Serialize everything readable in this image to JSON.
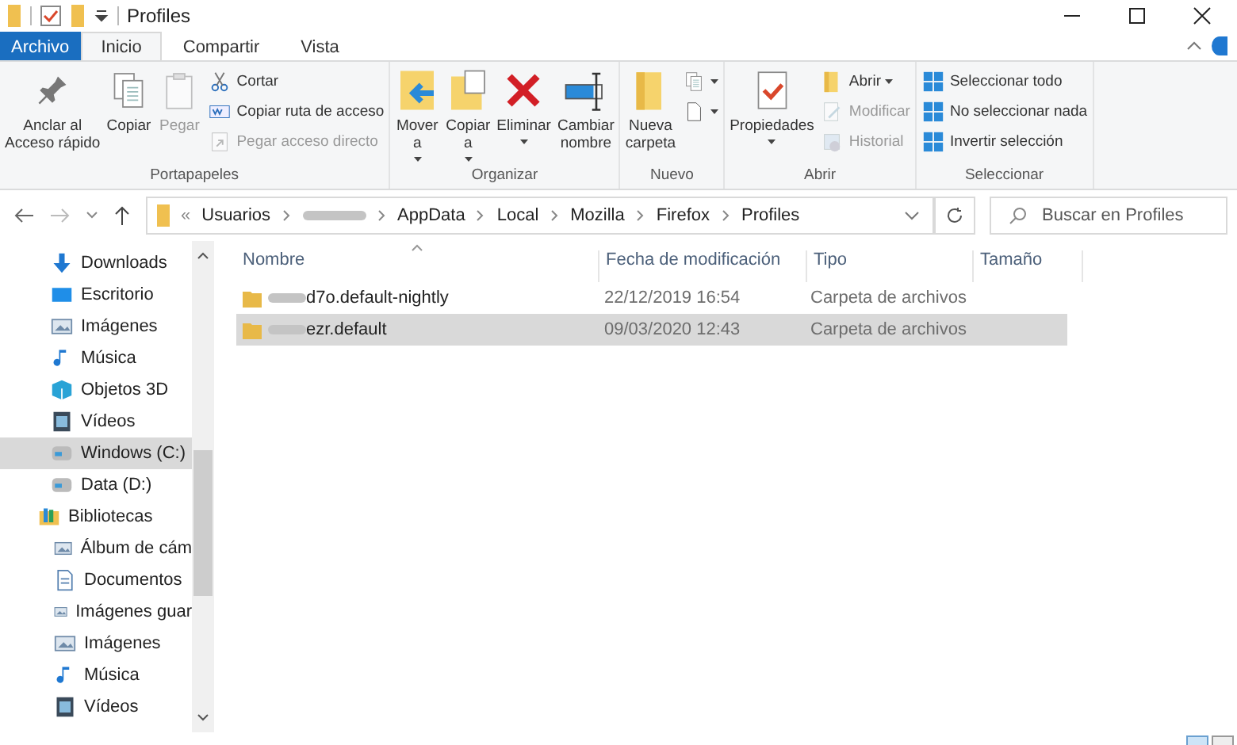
{
  "window": {
    "title": "Profiles"
  },
  "tabs": [
    {
      "label": "Archivo",
      "kind": "file",
      "selected": false
    },
    {
      "label": "Inicio",
      "kind": "tab",
      "selected": true
    },
    {
      "label": "Compartir",
      "kind": "tab",
      "selected": false
    },
    {
      "label": "Vista",
      "kind": "tab",
      "selected": false
    }
  ],
  "ribbon": [
    {
      "label": "Portapapeles",
      "items": [
        {
          "kind": "large",
          "lines": [
            "Anclar al",
            "Acceso rápido"
          ],
          "disabled": false,
          "dropdown": false
        },
        {
          "kind": "large",
          "lines": [
            "Copiar"
          ],
          "disabled": false,
          "dropdown": false
        },
        {
          "kind": "large",
          "lines": [
            "Pegar"
          ],
          "disabled": true,
          "dropdown": false
        },
        {
          "kind": "small",
          "label": "Cortar",
          "disabled": false,
          "dropdown": false
        },
        {
          "kind": "small",
          "label": "Copiar ruta de acceso",
          "disabled": false,
          "dropdown": false
        },
        {
          "kind": "small",
          "label": "Pegar acceso directo",
          "disabled": true,
          "dropdown": false
        }
      ]
    },
    {
      "label": "Organizar",
      "items": [
        {
          "kind": "large",
          "lines": [
            "Mover",
            "a"
          ],
          "disabled": false,
          "dropdown": true
        },
        {
          "kind": "large",
          "lines": [
            "Copiar",
            "a"
          ],
          "disabled": false,
          "dropdown": true
        },
        {
          "kind": "large",
          "lines": [
            "Eliminar"
          ],
          "disabled": false,
          "dropdown": true
        },
        {
          "kind": "large",
          "lines": [
            "Cambiar",
            "nombre"
          ],
          "disabled": false,
          "dropdown": false
        }
      ]
    },
    {
      "label": "Nuevo",
      "items": [
        {
          "kind": "large",
          "lines": [
            "Nueva",
            "carpeta"
          ],
          "disabled": false,
          "dropdown": false
        },
        {
          "kind": "small",
          "disabled": false,
          "dropdown": true
        },
        {
          "kind": "small",
          "disabled": false,
          "dropdown": true
        }
      ]
    },
    {
      "label": "Abrir",
      "items": [
        {
          "kind": "large",
          "lines": [
            "Propiedades"
          ],
          "disabled": false,
          "dropdown": true
        },
        {
          "kind": "small",
          "label": "Abrir",
          "disabled": false,
          "dropdown": true
        },
        {
          "kind": "small",
          "label": "Modificar",
          "disabled": true,
          "dropdown": false
        },
        {
          "kind": "small",
          "label": "Historial",
          "disabled": true,
          "dropdown": false
        }
      ]
    },
    {
      "label": "Seleccionar",
      "items": [
        {
          "kind": "small",
          "label": "Seleccionar todo",
          "disabled": false,
          "dropdown": false
        },
        {
          "kind": "small",
          "label": "No seleccionar nada",
          "disabled": false,
          "dropdown": false
        },
        {
          "kind": "small",
          "label": "Invertir selección",
          "disabled": false,
          "dropdown": false
        }
      ]
    }
  ],
  "address": {
    "separator": "«",
    "segments": [
      {
        "kind": "text",
        "label": "Usuarios"
      },
      {
        "kind": "redacted"
      },
      {
        "kind": "text",
        "label": "AppData"
      },
      {
        "kind": "text",
        "label": "Local"
      },
      {
        "kind": "text",
        "label": "Mozilla"
      },
      {
        "kind": "text",
        "label": "Firefox"
      },
      {
        "kind": "text",
        "label": "Profiles"
      }
    ]
  },
  "search": {
    "placeholder": "Buscar en Profiles"
  },
  "sidebar": {
    "items": [
      {
        "label": "Downloads",
        "selected": false
      },
      {
        "label": "Escritorio",
        "selected": false
      },
      {
        "label": "Imágenes",
        "selected": false
      },
      {
        "label": "Música",
        "selected": false
      },
      {
        "label": "Objetos 3D",
        "selected": false
      },
      {
        "label": "Vídeos",
        "selected": false
      },
      {
        "label": "Windows (C:)",
        "selected": true
      },
      {
        "label": "Data (D:)",
        "selected": false
      },
      {
        "label": "Bibliotecas",
        "selected": false,
        "children": [
          {
            "label": "Álbum de cám",
            "selected": false
          },
          {
            "label": "Documentos",
            "selected": false
          },
          {
            "label": "Imágenes guar",
            "selected": false
          },
          {
            "label": "Imágenes",
            "selected": false
          },
          {
            "label": "Música",
            "selected": false
          },
          {
            "label": "Vídeos",
            "selected": false
          }
        ]
      }
    ]
  },
  "table": {
    "columns": [
      "Nombre",
      "Fecha de modificación",
      "Tipo",
      "Tamaño"
    ],
    "rows": [
      {
        "name": "d7o.default-nightly",
        "redacted": true,
        "date": "22/12/2019 16:54",
        "type": "Carpeta de archivos",
        "selected": false
      },
      {
        "name": "ezr.default",
        "redacted": true,
        "date": "09/03/2020 12:43",
        "type": "Carpeta de archivos",
        "selected": true
      }
    ]
  }
}
